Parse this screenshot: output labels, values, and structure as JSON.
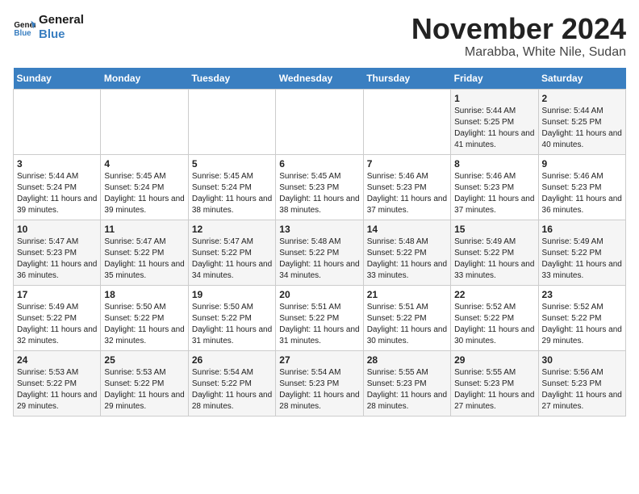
{
  "header": {
    "logo_line1": "General",
    "logo_line2": "Blue",
    "month_title": "November 2024",
    "location": "Marabba, White Nile, Sudan"
  },
  "weekdays": [
    "Sunday",
    "Monday",
    "Tuesday",
    "Wednesday",
    "Thursday",
    "Friday",
    "Saturday"
  ],
  "weeks": [
    [
      {
        "day": "",
        "info": ""
      },
      {
        "day": "",
        "info": ""
      },
      {
        "day": "",
        "info": ""
      },
      {
        "day": "",
        "info": ""
      },
      {
        "day": "",
        "info": ""
      },
      {
        "day": "1",
        "info": "Sunrise: 5:44 AM\nSunset: 5:25 PM\nDaylight: 11 hours and 41 minutes."
      },
      {
        "day": "2",
        "info": "Sunrise: 5:44 AM\nSunset: 5:25 PM\nDaylight: 11 hours and 40 minutes."
      }
    ],
    [
      {
        "day": "3",
        "info": "Sunrise: 5:44 AM\nSunset: 5:24 PM\nDaylight: 11 hours and 39 minutes."
      },
      {
        "day": "4",
        "info": "Sunrise: 5:45 AM\nSunset: 5:24 PM\nDaylight: 11 hours and 39 minutes."
      },
      {
        "day": "5",
        "info": "Sunrise: 5:45 AM\nSunset: 5:24 PM\nDaylight: 11 hours and 38 minutes."
      },
      {
        "day": "6",
        "info": "Sunrise: 5:45 AM\nSunset: 5:23 PM\nDaylight: 11 hours and 38 minutes."
      },
      {
        "day": "7",
        "info": "Sunrise: 5:46 AM\nSunset: 5:23 PM\nDaylight: 11 hours and 37 minutes."
      },
      {
        "day": "8",
        "info": "Sunrise: 5:46 AM\nSunset: 5:23 PM\nDaylight: 11 hours and 37 minutes."
      },
      {
        "day": "9",
        "info": "Sunrise: 5:46 AM\nSunset: 5:23 PM\nDaylight: 11 hours and 36 minutes."
      }
    ],
    [
      {
        "day": "10",
        "info": "Sunrise: 5:47 AM\nSunset: 5:23 PM\nDaylight: 11 hours and 36 minutes."
      },
      {
        "day": "11",
        "info": "Sunrise: 5:47 AM\nSunset: 5:22 PM\nDaylight: 11 hours and 35 minutes."
      },
      {
        "day": "12",
        "info": "Sunrise: 5:47 AM\nSunset: 5:22 PM\nDaylight: 11 hours and 34 minutes."
      },
      {
        "day": "13",
        "info": "Sunrise: 5:48 AM\nSunset: 5:22 PM\nDaylight: 11 hours and 34 minutes."
      },
      {
        "day": "14",
        "info": "Sunrise: 5:48 AM\nSunset: 5:22 PM\nDaylight: 11 hours and 33 minutes."
      },
      {
        "day": "15",
        "info": "Sunrise: 5:49 AM\nSunset: 5:22 PM\nDaylight: 11 hours and 33 minutes."
      },
      {
        "day": "16",
        "info": "Sunrise: 5:49 AM\nSunset: 5:22 PM\nDaylight: 11 hours and 33 minutes."
      }
    ],
    [
      {
        "day": "17",
        "info": "Sunrise: 5:49 AM\nSunset: 5:22 PM\nDaylight: 11 hours and 32 minutes."
      },
      {
        "day": "18",
        "info": "Sunrise: 5:50 AM\nSunset: 5:22 PM\nDaylight: 11 hours and 32 minutes."
      },
      {
        "day": "19",
        "info": "Sunrise: 5:50 AM\nSunset: 5:22 PM\nDaylight: 11 hours and 31 minutes."
      },
      {
        "day": "20",
        "info": "Sunrise: 5:51 AM\nSunset: 5:22 PM\nDaylight: 11 hours and 31 minutes."
      },
      {
        "day": "21",
        "info": "Sunrise: 5:51 AM\nSunset: 5:22 PM\nDaylight: 11 hours and 30 minutes."
      },
      {
        "day": "22",
        "info": "Sunrise: 5:52 AM\nSunset: 5:22 PM\nDaylight: 11 hours and 30 minutes."
      },
      {
        "day": "23",
        "info": "Sunrise: 5:52 AM\nSunset: 5:22 PM\nDaylight: 11 hours and 29 minutes."
      }
    ],
    [
      {
        "day": "24",
        "info": "Sunrise: 5:53 AM\nSunset: 5:22 PM\nDaylight: 11 hours and 29 minutes."
      },
      {
        "day": "25",
        "info": "Sunrise: 5:53 AM\nSunset: 5:22 PM\nDaylight: 11 hours and 29 minutes."
      },
      {
        "day": "26",
        "info": "Sunrise: 5:54 AM\nSunset: 5:22 PM\nDaylight: 11 hours and 28 minutes."
      },
      {
        "day": "27",
        "info": "Sunrise: 5:54 AM\nSunset: 5:23 PM\nDaylight: 11 hours and 28 minutes."
      },
      {
        "day": "28",
        "info": "Sunrise: 5:55 AM\nSunset: 5:23 PM\nDaylight: 11 hours and 28 minutes."
      },
      {
        "day": "29",
        "info": "Sunrise: 5:55 AM\nSunset: 5:23 PM\nDaylight: 11 hours and 27 minutes."
      },
      {
        "day": "30",
        "info": "Sunrise: 5:56 AM\nSunset: 5:23 PM\nDaylight: 11 hours and 27 minutes."
      }
    ]
  ]
}
